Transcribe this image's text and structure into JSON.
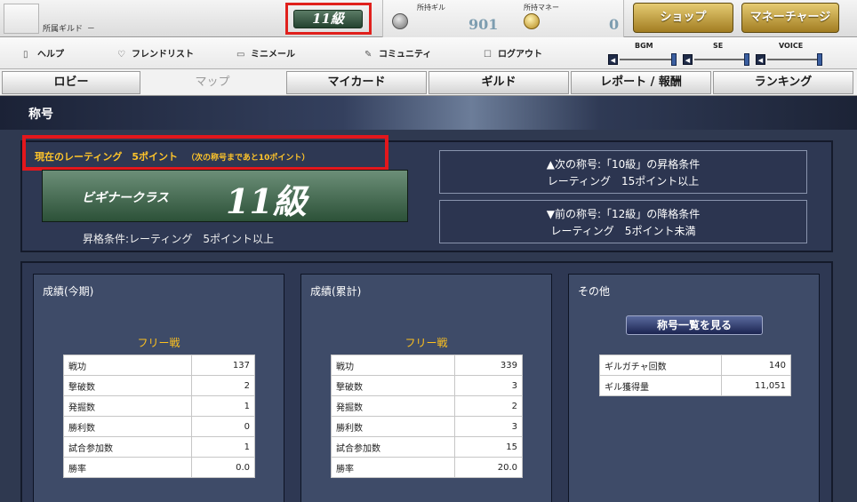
{
  "header": {
    "guild_label": "所属ギルド",
    "guild_value": "－",
    "rank_badge": "11級",
    "gil_label": "所持ギル",
    "gil_value": "901",
    "money_label": "所持マネー",
    "money_value": "0",
    "shop_label": "ショップ",
    "charge_label": "マネーチャージ"
  },
  "links": {
    "help": "ヘルプ",
    "friends": "フレンドリスト",
    "mail": "ミニメール",
    "community": "コミュニティ",
    "logout": "ログアウト"
  },
  "volume": {
    "bgm": "BGM",
    "se": "SE",
    "voice": "VOICE"
  },
  "tabs": [
    "ロビー",
    "マップ",
    "マイカード",
    "ギルド",
    "レポート / 報酬",
    "ランキング"
  ],
  "page_title": "称号",
  "rating": {
    "current": "現在のレーティング　5ポイント",
    "to_next": "（次の称号まであと10ポイント）",
    "class_name": "ビギナークラス",
    "rank": "11級",
    "condition": "昇格条件:レーティング　5ポイント以上",
    "next_title": "▲次の称号:「10級」の昇格条件",
    "next_req": "レーティング　15ポイント以上",
    "prev_title": "▼前の称号:「12級」の降格条件",
    "prev_req": "レーティング　5ポイント未満"
  },
  "stats": {
    "period": {
      "title": "成績(今期)",
      "mode": "フリー戦",
      "rows": [
        {
          "label": "戦功",
          "value": "137"
        },
        {
          "label": "撃破数",
          "value": "2"
        },
        {
          "label": "発掘数",
          "value": "1"
        },
        {
          "label": "勝利数",
          "value": "0"
        },
        {
          "label": "試合参加数",
          "value": "1"
        },
        {
          "label": "勝率",
          "value": "0.0"
        }
      ]
    },
    "total": {
      "title": "成績(累計)",
      "mode": "フリー戦",
      "rows": [
        {
          "label": "戦功",
          "value": "339"
        },
        {
          "label": "撃破数",
          "value": "3"
        },
        {
          "label": "発掘数",
          "value": "2"
        },
        {
          "label": "勝利数",
          "value": "3"
        },
        {
          "label": "試合参加数",
          "value": "15"
        },
        {
          "label": "勝率",
          "value": "20.0"
        }
      ]
    },
    "other": {
      "title": "その他",
      "button": "称号一覧を見る",
      "rows": [
        {
          "label": "ギルガチャ回数",
          "value": "140"
        },
        {
          "label": "ギル獲得量",
          "value": "11,051"
        }
      ]
    }
  },
  "colors": {
    "accent_gold": "#ffc52a",
    "highlight_red": "#e3171c",
    "panel_dark": "#2e3853"
  }
}
